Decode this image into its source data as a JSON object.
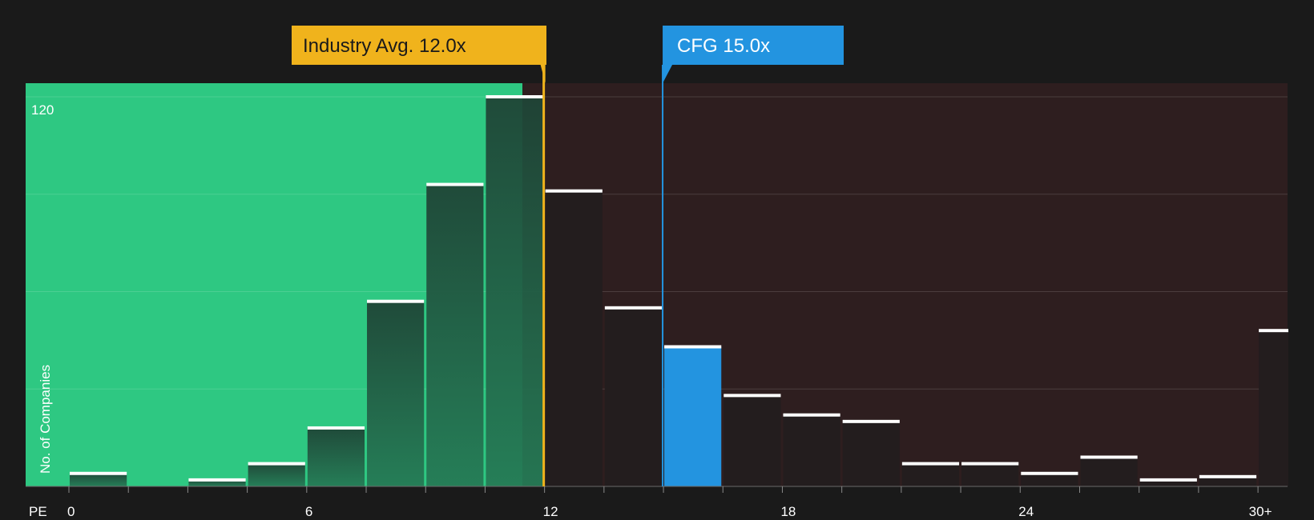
{
  "chart_data": {
    "type": "bar",
    "xlabel": "PE",
    "ylabel": "No. of Companies",
    "y_tick_label": "120",
    "ylim": [
      0,
      124
    ],
    "x_ticks": [
      {
        "value": 0,
        "label": "0"
      },
      {
        "value": 6,
        "label": "6"
      },
      {
        "value": 12,
        "label": "12"
      },
      {
        "value": 18,
        "label": "18"
      },
      {
        "value": 24,
        "label": "24"
      },
      {
        "value": 30,
        "label": "30+"
      }
    ],
    "bin_width": 1.5,
    "bins": [
      {
        "start": 0,
        "value": 4
      },
      {
        "start": 1.5,
        "value": 0
      },
      {
        "start": 3,
        "value": 2
      },
      {
        "start": 4.5,
        "value": 7
      },
      {
        "start": 6,
        "value": 18
      },
      {
        "start": 7.5,
        "value": 57
      },
      {
        "start": 9,
        "value": 93
      },
      {
        "start": 10.5,
        "value": 120
      },
      {
        "start": 12,
        "value": 91
      },
      {
        "start": 13.5,
        "value": 55
      },
      {
        "start": 15,
        "value": 43
      },
      {
        "start": 16.5,
        "value": 28
      },
      {
        "start": 18,
        "value": 22
      },
      {
        "start": 19.5,
        "value": 20
      },
      {
        "start": 21,
        "value": 7
      },
      {
        "start": 22.5,
        "value": 7
      },
      {
        "start": 24,
        "value": 4
      },
      {
        "start": 25.5,
        "value": 9
      },
      {
        "start": 27,
        "value": 2
      },
      {
        "start": 28.5,
        "value": 3
      },
      {
        "start": 30,
        "value": 48
      }
    ],
    "industry_avg": {
      "value": 12.0,
      "label": "Industry Avg. 12.0x"
    },
    "company": {
      "value": 15.0,
      "label": "CFG 15.0x",
      "bin_start": 15
    },
    "colors": {
      "background": "#1a1a1a",
      "below_region": "#2ec882",
      "above_region": "#2e1e1f",
      "bar_in_below": "#1f4a38",
      "bar_above": "#231d1e",
      "company_bar": "#2394e0",
      "industry_marker": "#f0b31c",
      "company_marker": "#2394e0",
      "bar_cap": "#ffffff",
      "grid": "#ffffff"
    }
  }
}
